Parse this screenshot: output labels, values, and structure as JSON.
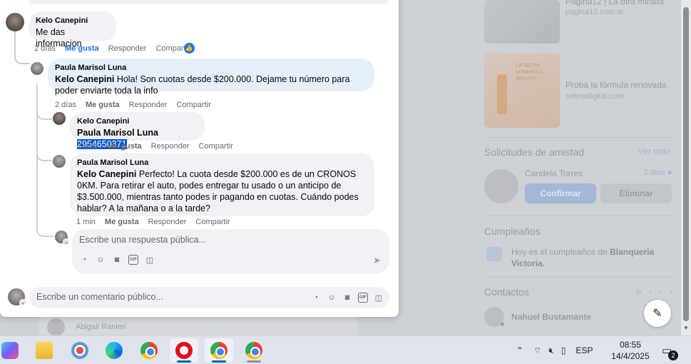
{
  "comments": [
    {
      "author": "Kelo Canepini",
      "text": "Me das informacion",
      "time": "2 días",
      "like": "Me gusta",
      "reply": "Responder",
      "share": "Compartir"
    },
    {
      "author": "Paula Marisol Luna",
      "mention": "Kelo Canepini",
      "text": "Hola! Son cuotas desde $200.000. Dejame tu número para poder enviarte toda la info",
      "time": "2 días",
      "like": "Me gusta",
      "reply": "Responder",
      "share": "Compartir"
    },
    {
      "author": "Kelo Canepini",
      "mention": "Paula Marisol Luna",
      "text": "2954650371",
      "time": "2 días",
      "like": "Me gusta",
      "reply": "Responder",
      "share": "Compartir"
    },
    {
      "author": "Paula Marisol Luna",
      "mention": "Kelo Canepini",
      "text": "Perfecto! La cuota desde $200.000 es de un CRONOS 0KM. Para retirar el auto, podes entregar tu usado o un anticipo de $3.500.000, mientras tanto podes ir pagando en cuotas. Cuándo podes hablar? A la mañana o a la tarde?",
      "time": "1 min",
      "like": "Me gusta",
      "reply": "Responder",
      "share": "Compartir"
    }
  ],
  "reply_box": {
    "placeholder": "Escribe una respuesta pública..."
  },
  "comment_box": {
    "placeholder": "Escribe un comentario público..."
  },
  "background": {
    "ads": [
      {
        "title": "Pagina12 | La otra mirada",
        "site": "pagina12.com.ar"
      },
      {
        "title": "Probá la fórmula renovada",
        "site": "selmadigital.com",
        "image_text": [
          "LIFTACTIV",
          "VITAMINA C",
          "35% OFF"
        ]
      }
    ],
    "friend_requests": {
      "title": "Solicitudes de amistad",
      "see_all": "Ver todo",
      "name": "Candela Torres",
      "time": "2 días",
      "confirm": "Confirmar",
      "delete": "Eliminar"
    },
    "birthdays": {
      "title": "Cumpleaños",
      "text_prefix": "Hoy es el cumpleaños de ",
      "name": "Blanqueria Victoria."
    },
    "contacts": {
      "title": "Contactos",
      "name": "Nahuel Bustamante"
    },
    "feed_name": "Abigail Ranieri"
  },
  "taskbar": {
    "language": "ESP",
    "time": "08:55",
    "date": "14/4/2025",
    "notifications": "2"
  },
  "colors": {
    "facebook_blue": "#1b74e4",
    "selection": "#0b57d0",
    "bubble": "#f0f2f5"
  }
}
